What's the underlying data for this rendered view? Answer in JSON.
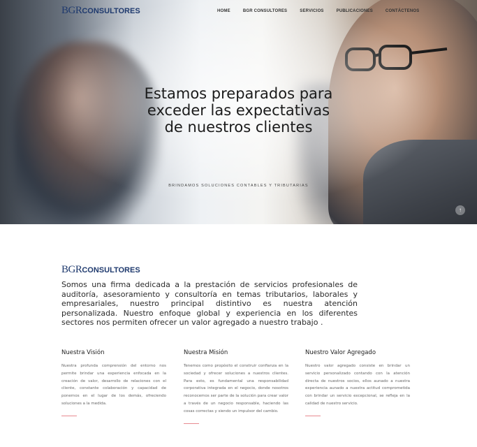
{
  "nav": {
    "logo_mark": "BGR",
    "logo_text": "CONSULTORES",
    "links": [
      "HOME",
      "BGR CONSULTORES",
      "SERVICIOS",
      "PUBLICACIONES",
      "CONTÁCTENOS"
    ]
  },
  "hero": {
    "title": "Estamos preparados para exceder las expectativas de nuestros clientes",
    "subtitle": "BRINDAMOS SOLUCIONES CONTABLES Y TRIBUTARIAS",
    "scroll_icon": "↑"
  },
  "about": {
    "logo_mark": "BGR",
    "logo_text": "CONSULTORES",
    "text": "Somos una firma dedicada a la prestación de servicios profesionales de auditoría, asesoramiento y consultoría en temas tributarios, laborales y empresariales, nuestro principal distintivo es nuestra atención personalizada. Nuestro enfoque global y experiencia en los diferentes sectores nos permiten ofrecer un valor agregado a nuestro trabajo ."
  },
  "columns": [
    {
      "title": "Nuestra Visión",
      "text": "Nuestra profunda comprensión del entorno nos permite brindar una experiencia enfocada en la creación de valor, desarrollo de relaciones con el cliente, constante colaboración y capacidad de ponernos en el lugar de los demás, ofreciendo soluciones a la medida."
    },
    {
      "title": "Nuestra Misión",
      "text": "Tenemos como propósito el construir confianza en la sociedad y ofrecer soluciones a nuestros clientes. Para esto, es fundamental una responsabilidad corporativa integrada en el negocio, donde nosotros reconocemos ser parte de la solución para crear valor a través de un negocio responsable, haciendo las cosas correctas y siendo un impulsor del cambio."
    },
    {
      "title": "Nuestro Valor Agregado",
      "text": "Nuestro valor agregado consiste en brindar un servicio personalizado contando con la atención directa de nuestros socios, ellos aunado a nuestra experiencia aunado a nuestra actitud comprometida con brindar un servicio excepcional, se refleja en la calidad de nuestro servicio."
    }
  ]
}
